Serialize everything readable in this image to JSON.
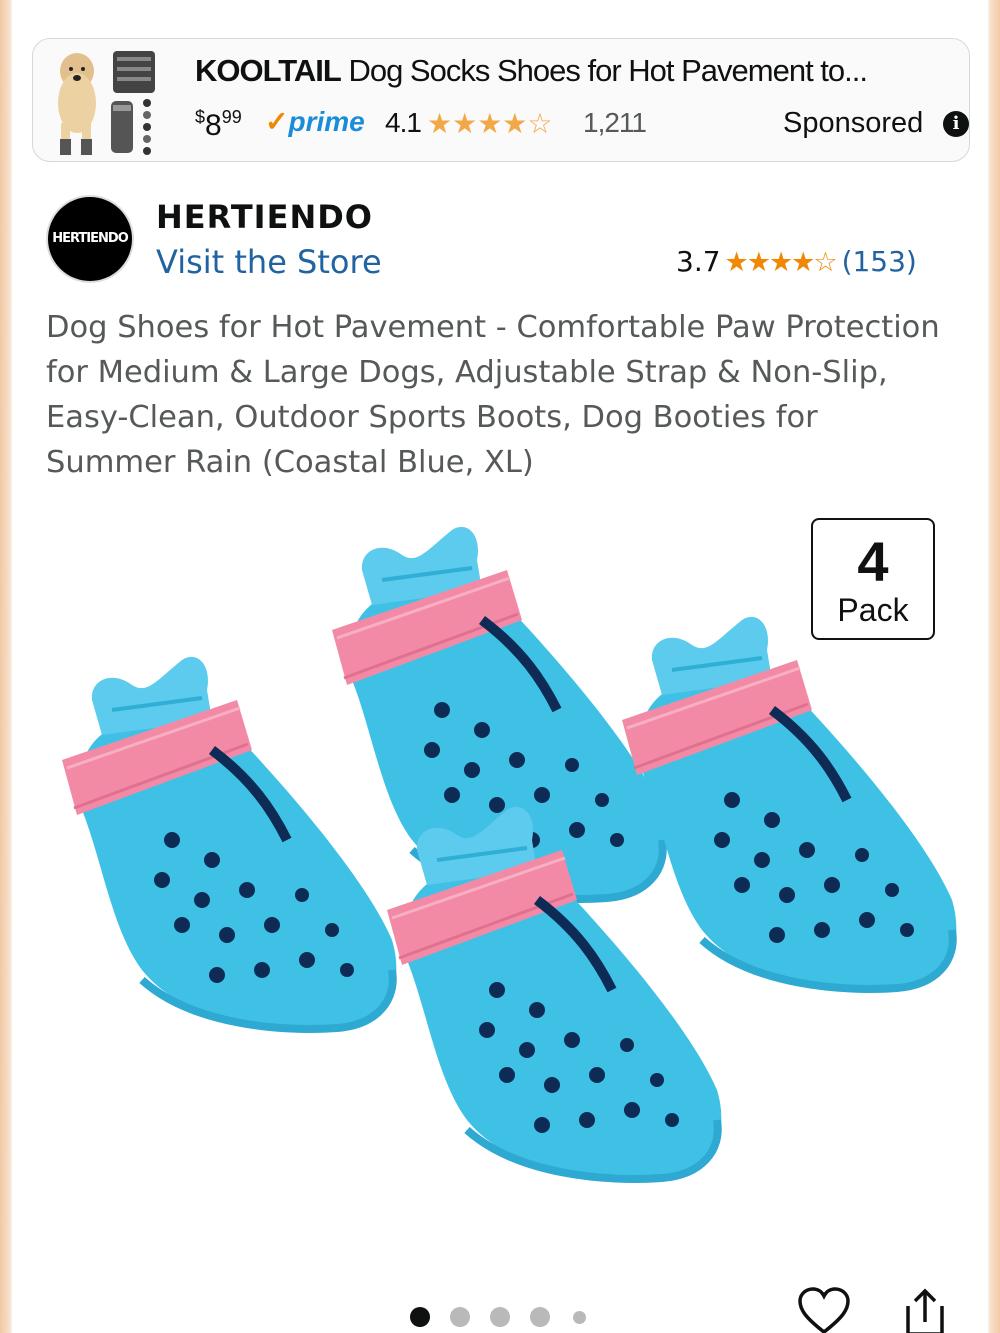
{
  "ad": {
    "brand": "KOOLTAIL",
    "title": "Dog Socks Shoes for Hot Pavement to...",
    "price_symbol": "$",
    "price_whole": "8",
    "price_cents": "99",
    "prime_label": "prime",
    "rating": "4.1",
    "stars": "★★★★☆",
    "rating_count": "1,211",
    "sponsored_label": "Sponsored",
    "info_glyph": "i"
  },
  "brand": {
    "logo_text": "HERTIENDO",
    "name": "HERTIENDO",
    "visit_store": "Visit the Store",
    "rating": "3.7",
    "stars": "★★★★☆",
    "rating_count": "(153)"
  },
  "product": {
    "title": "Dog Shoes for Hot Pavement - Comfortable Paw Protection for Medium & Large Dogs, Adjustable Strap & Non-Slip, Easy-Clean, Outdoor Sports Boots, Dog Booties for Summer Rain (Coastal Blue, XL)",
    "badge_number": "4",
    "badge_label": "Pack",
    "shoe_color": "#3fc1e6",
    "strap_color": "#f28aa6"
  },
  "carousel": {
    "total_dots": 5,
    "active_index": 0
  },
  "icons": {
    "favorite": "heart-icon",
    "share": "share-icon"
  }
}
